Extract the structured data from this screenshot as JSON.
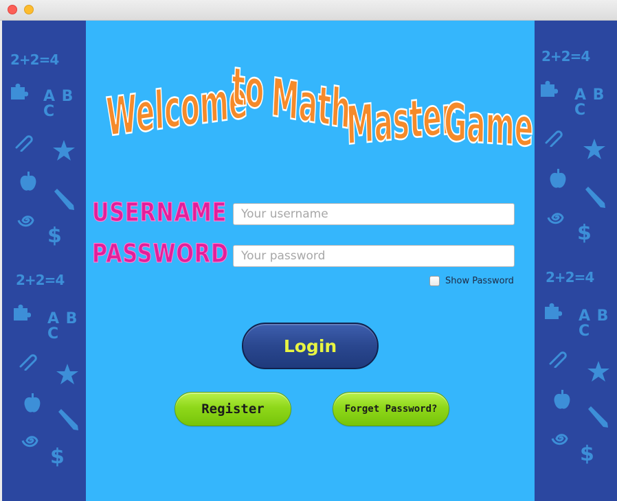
{
  "window": {
    "controls": [
      "close",
      "minimize"
    ]
  },
  "title": {
    "words": [
      "Welcome",
      "to",
      "Math",
      "Master",
      "Game"
    ]
  },
  "form": {
    "username_label": "USERNAME",
    "username_placeholder": "Your username",
    "username_value": "",
    "password_label": "PASSWORD",
    "password_placeholder": "Your password",
    "password_value": "",
    "show_password_label": "Show Password",
    "show_password_checked": false
  },
  "buttons": {
    "login": "Login",
    "register": "Register",
    "forget_password": "Forget Password?"
  },
  "decorations": {
    "equation": "2+2=4",
    "letters": "A B C",
    "dollar": "$",
    "icons": [
      "puzzle-icon",
      "paperclip-icon",
      "star-icon",
      "apple-icon",
      "pencil-icon",
      "spiral-icon"
    ]
  },
  "colors": {
    "main_bg": "#35b6fc",
    "side_bg": "#2b47a0",
    "title_orange": "#f58a2a",
    "label_pink": "#e21f9a",
    "login_button": "#2a478f",
    "login_text": "#e8f542",
    "green_button": "#8fd81a"
  }
}
